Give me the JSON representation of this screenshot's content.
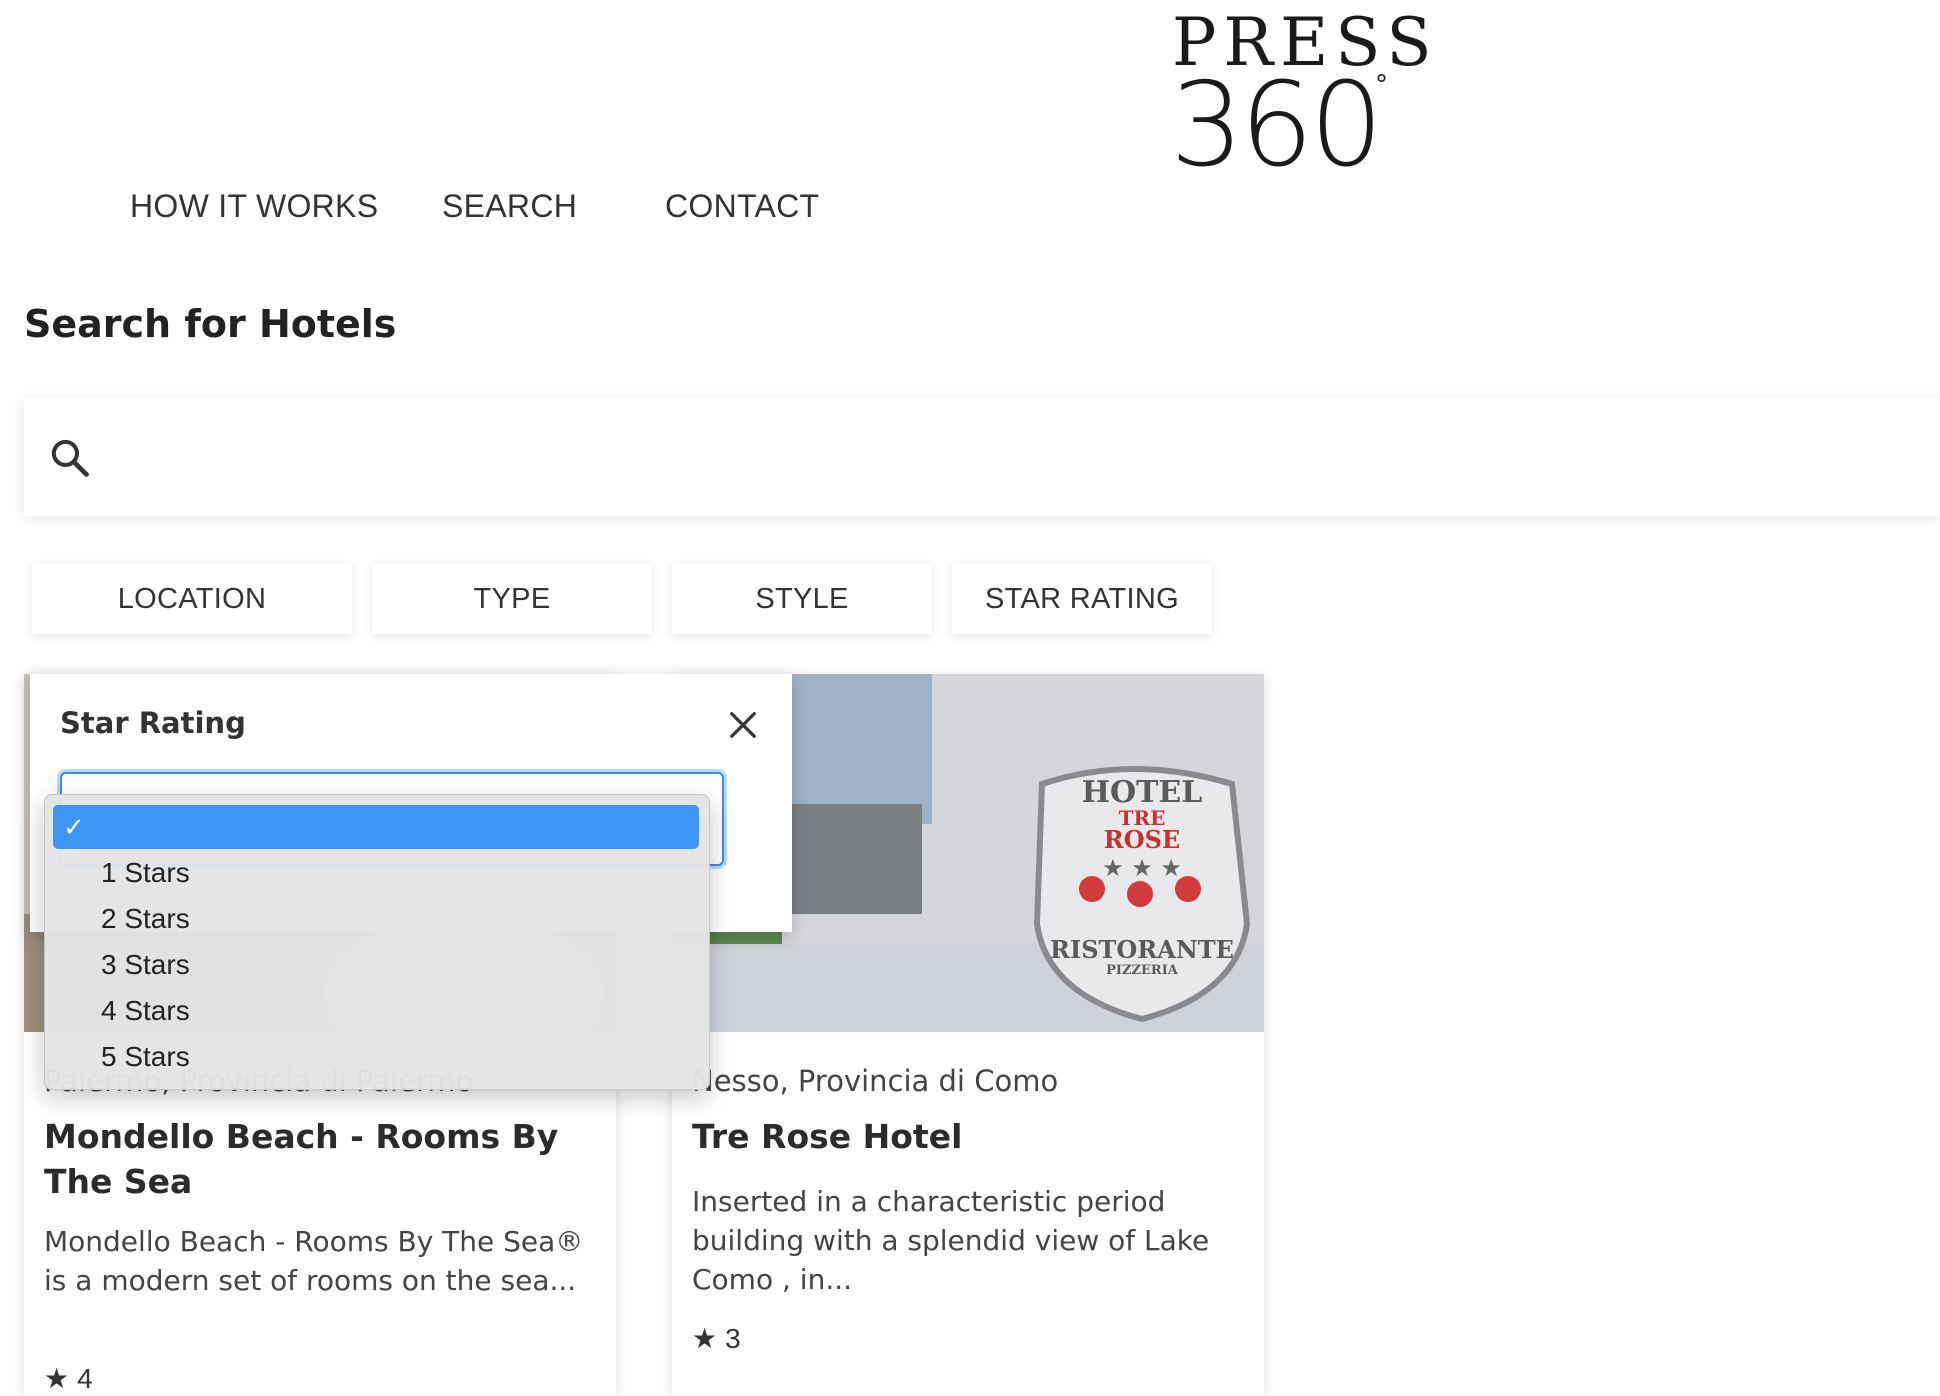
{
  "logo": {
    "line1": "PRESS",
    "line2": "360",
    "degree": "°"
  },
  "nav": {
    "items": [
      "HOW IT WORKS",
      "SEARCH",
      "CONTACT"
    ]
  },
  "page": {
    "title": "Search for Hotels"
  },
  "search": {
    "value": "",
    "placeholder": ""
  },
  "filters": [
    "LOCATION",
    "TYPE",
    "STYLE",
    "STAR RATING"
  ],
  "popover": {
    "title": "Star Rating",
    "selected": ""
  },
  "dropdown": {
    "options": [
      "",
      "1 Stars",
      "2 Stars",
      "3 Stars",
      "4 Stars",
      "5 Stars"
    ],
    "selected_index": 0,
    "check": "✓"
  },
  "cards": [
    {
      "location": "Palermo, Provincia di Palermo",
      "name": "Mondello Beach - Rooms By The Sea",
      "description": "Mondello Beach - Rooms By The Sea® is a modern set of rooms on the sea...",
      "rating": "4"
    },
    {
      "location": "Nesso, Provincia di Como",
      "name": "Tre Rose Hotel",
      "description": "Inserted in a characteristic period building with a splendid view of  Lake Como , in...",
      "rating": "3",
      "sign": {
        "line1": "HOTEL",
        "line2": "TRE",
        "line3": "ROSE",
        "stars": "★ ★ ★",
        "line4": "RISTORANTE",
        "line5": "PIZZERIA"
      }
    }
  ],
  "colors": {
    "accent": "#3d95f6",
    "focus_border": "#3b8eea"
  }
}
